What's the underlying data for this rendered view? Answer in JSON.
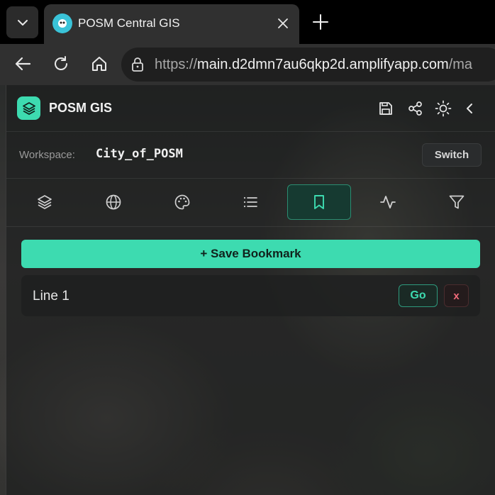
{
  "browser": {
    "tab_title": "POSM Central GIS",
    "url_prefix": "https://",
    "url_host": "main.d2dmn7au6qkp2d.amplifyapp.com",
    "url_suffix": "/ma"
  },
  "app": {
    "title": "POSM GIS",
    "header_icons": [
      "save-icon",
      "share-icon",
      "theme-sun-icon",
      "collapse-chevron-icon"
    ]
  },
  "workspace": {
    "label": "Workspace:",
    "name": "City_of_POSM",
    "switch_label": "Switch"
  },
  "tool_tabs": [
    {
      "icon": "layers-icon",
      "active": false
    },
    {
      "icon": "globe-icon",
      "active": false
    },
    {
      "icon": "palette-icon",
      "active": false
    },
    {
      "icon": "list-icon",
      "active": false
    },
    {
      "icon": "bookmark-icon",
      "active": true
    },
    {
      "icon": "activity-icon",
      "active": false
    },
    {
      "icon": "filter-icon",
      "active": false
    }
  ],
  "bookmarks": {
    "save_label": "+ Save Bookmark",
    "items": [
      {
        "name": "Line 1",
        "go_label": "Go",
        "delete_label": "x"
      }
    ]
  },
  "colors": {
    "accent": "#3ddbb0",
    "danger": "#f26b7a",
    "active_tab_bg": "#163a31"
  }
}
